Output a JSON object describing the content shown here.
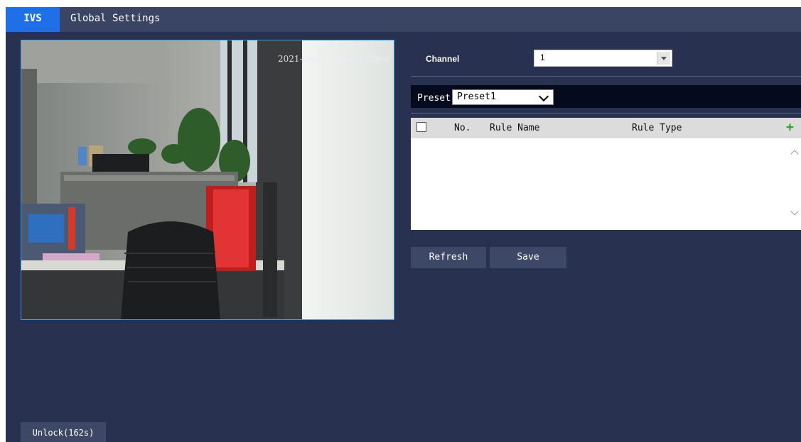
{
  "tabs": {
    "ivs": "IVS",
    "global_settings": "Global Settings"
  },
  "video": {
    "timestamp": "2021-09-01 15:09:45 Wed"
  },
  "channel": {
    "label": "Channel",
    "value": "1"
  },
  "preset": {
    "label": "Preset",
    "value": "Preset1"
  },
  "rules_table": {
    "columns": {
      "no": "No.",
      "rule_name": "Rule Name",
      "rule_type": "Rule Type"
    },
    "add_icon": "+",
    "rows": []
  },
  "buttons": {
    "refresh": "Refresh",
    "save": "Save",
    "unlock": "Unlock(162s)"
  },
  "colors": {
    "background": "#283250",
    "active_tab": "#1f6fe8",
    "add_icon": "#22aa22"
  }
}
